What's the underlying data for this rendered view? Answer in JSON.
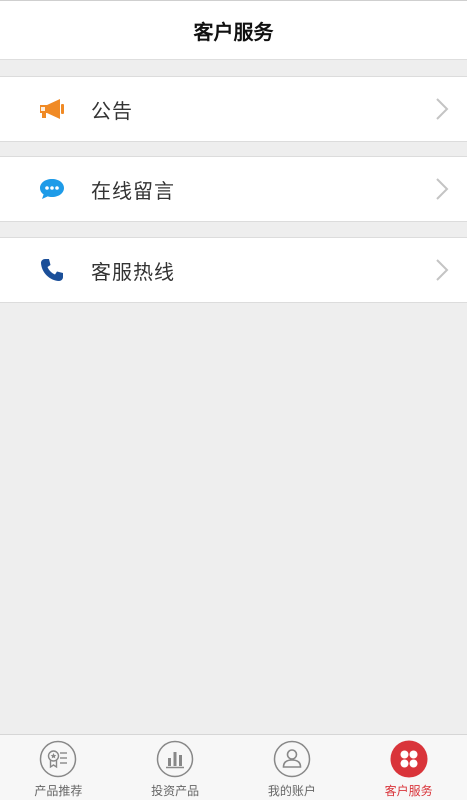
{
  "header": {
    "title": "客户服务"
  },
  "menu": {
    "items": [
      {
        "label": "公告",
        "icon": "megaphone-icon",
        "icon_color": "#f08a25"
      },
      {
        "label": "在线留言",
        "icon": "chat-bubble-icon",
        "icon_color": "#1e9be8"
      },
      {
        "label": "客服热线",
        "icon": "phone-icon",
        "icon_color": "#1b4f99"
      }
    ]
  },
  "tabbar": {
    "tabs": [
      {
        "label": "产品推荐",
        "icon": "award-list-icon",
        "active": false
      },
      {
        "label": "投资产品",
        "icon": "bar-chart-icon",
        "active": false
      },
      {
        "label": "我的账户",
        "icon": "user-icon",
        "active": false
      },
      {
        "label": "客户服务",
        "icon": "service-grid-icon",
        "active": true
      }
    ],
    "active_color": "#d9343a",
    "inactive_color": "#888888"
  }
}
